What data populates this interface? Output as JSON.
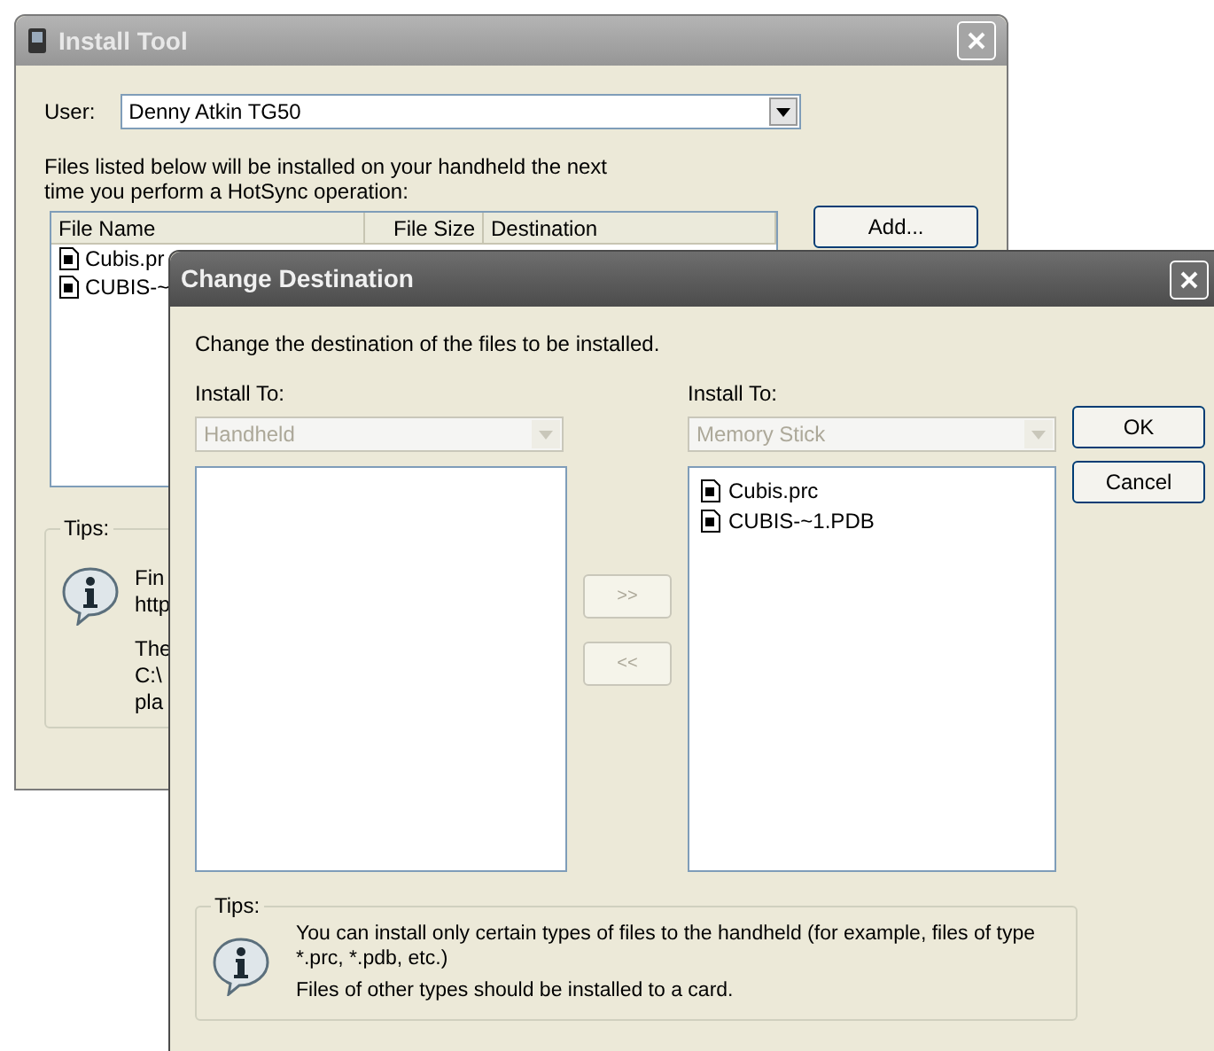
{
  "install_tool": {
    "title": "Install Tool",
    "user_label": "User:",
    "user": {
      "value": "Denny Atkin TG50"
    },
    "description": "Files listed below will be installed on your handheld the next time you perform a HotSync operation:",
    "table": {
      "columns": [
        "File Name",
        "File Size",
        "Destination"
      ],
      "rows": [
        {
          "name": "Cubis.pr"
        },
        {
          "name": "CUBIS-~"
        }
      ]
    },
    "add_button": "Add...",
    "tips": {
      "title": "Tips:",
      "lines": [
        "Fin",
        "http",
        "The",
        "C:\\",
        "pla"
      ]
    }
  },
  "change_destination": {
    "title": "Change Destination",
    "description": "Change the destination of the files to be installed.",
    "source": {
      "label": "Install To:",
      "combo": {
        "value": "Handheld",
        "disabled": true
      }
    },
    "move_buttons": [
      {
        "label": ">>",
        "disabled": true
      },
      {
        "label": "<<",
        "disabled": true
      }
    ],
    "target": {
      "label": "Install To:",
      "combo": {
        "value": "Memory Stick",
        "disabled": true
      },
      "files": [
        "Cubis.prc",
        "CUBIS-~1.PDB"
      ]
    },
    "buttons": [
      "OK",
      "Cancel"
    ],
    "tips": {
      "title": "Tips:",
      "paragraphs": [
        "You can install only certain types of files to the handheld (for example, files of type *.prc, *.pdb, etc.)",
        "Files of other types should be installed to a card."
      ]
    }
  }
}
